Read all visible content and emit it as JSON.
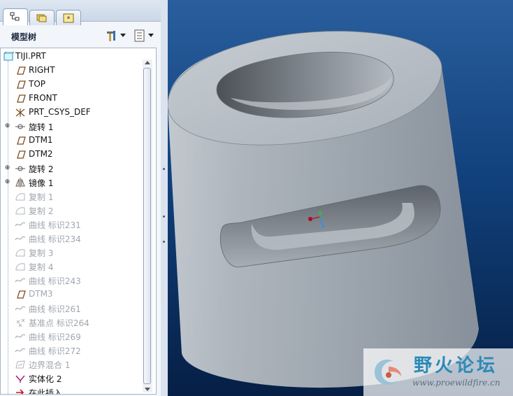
{
  "panel": {
    "title": "模型树",
    "tabs": [
      {
        "icon": "model-tree-icon",
        "active": true
      },
      {
        "icon": "folder-browser-icon",
        "active": false
      },
      {
        "icon": "favorites-icon",
        "active": false
      }
    ],
    "header_buttons": [
      {
        "icon": "tools-icon"
      },
      {
        "icon": "show-settings-icon"
      }
    ]
  },
  "tree": {
    "root": "TIJI.PRT",
    "items": [
      {
        "label": "RIGHT",
        "icon": "datum-plane-icon",
        "dim": false,
        "expandable": false
      },
      {
        "label": "TOP",
        "icon": "datum-plane-icon",
        "dim": false,
        "expandable": false
      },
      {
        "label": "FRONT",
        "icon": "datum-plane-icon",
        "dim": false,
        "expandable": false
      },
      {
        "label": "PRT_CSYS_DEF",
        "icon": "coordinate-system-icon",
        "dim": false,
        "expandable": false
      },
      {
        "label": "旋转 1",
        "icon": "revolve-icon",
        "dim": false,
        "expandable": true
      },
      {
        "label": "DTM1",
        "icon": "datum-plane-icon",
        "dim": false,
        "expandable": false
      },
      {
        "label": "DTM2",
        "icon": "datum-plane-icon",
        "dim": false,
        "expandable": false
      },
      {
        "label": "旋转 2",
        "icon": "revolve-icon",
        "dim": false,
        "expandable": true
      },
      {
        "label": "镜像 1",
        "icon": "mirror-icon",
        "dim": false,
        "expandable": true
      },
      {
        "label": "复制 1",
        "icon": "copy-surface-icon",
        "dim": true,
        "expandable": false
      },
      {
        "label": "复制 2",
        "icon": "copy-surface-icon",
        "dim": true,
        "expandable": false
      },
      {
        "label": "曲线 标识231",
        "icon": "curve-icon",
        "dim": true,
        "expandable": false
      },
      {
        "label": "曲线 标识234",
        "icon": "curve-icon",
        "dim": true,
        "expandable": false
      },
      {
        "label": "复制 3",
        "icon": "copy-surface-icon",
        "dim": true,
        "expandable": false
      },
      {
        "label": "复制 4",
        "icon": "copy-surface-icon",
        "dim": true,
        "expandable": false
      },
      {
        "label": "曲线 标识243",
        "icon": "curve-icon",
        "dim": true,
        "expandable": false
      },
      {
        "label": "DTM3",
        "icon": "datum-plane-icon",
        "dim": true,
        "expandable": false
      },
      {
        "label": "曲线 标识261",
        "icon": "curve-icon",
        "dim": true,
        "expandable": false
      },
      {
        "label": "基准点 标识264",
        "icon": "datum-point-icon",
        "dim": true,
        "expandable": false
      },
      {
        "label": "曲线 标识269",
        "icon": "curve-icon",
        "dim": true,
        "expandable": false
      },
      {
        "label": "曲线 标识272",
        "icon": "curve-icon",
        "dim": true,
        "expandable": false
      },
      {
        "label": "边界混合 1",
        "icon": "boundary-blend-icon",
        "dim": true,
        "expandable": false
      },
      {
        "label": "实体化 2",
        "icon": "solidify-icon",
        "dim": false,
        "expandable": false
      },
      {
        "label": "在此插入",
        "icon": "insert-here-icon",
        "dim": false,
        "expandable": false
      }
    ]
  },
  "watermark": {
    "title": "野火论坛",
    "url": "www.proewildfire.cn"
  },
  "colors": {
    "viewport_top": "#2a5e9d",
    "viewport_bottom": "#061f45",
    "model_surface": "#9aa3ad"
  }
}
